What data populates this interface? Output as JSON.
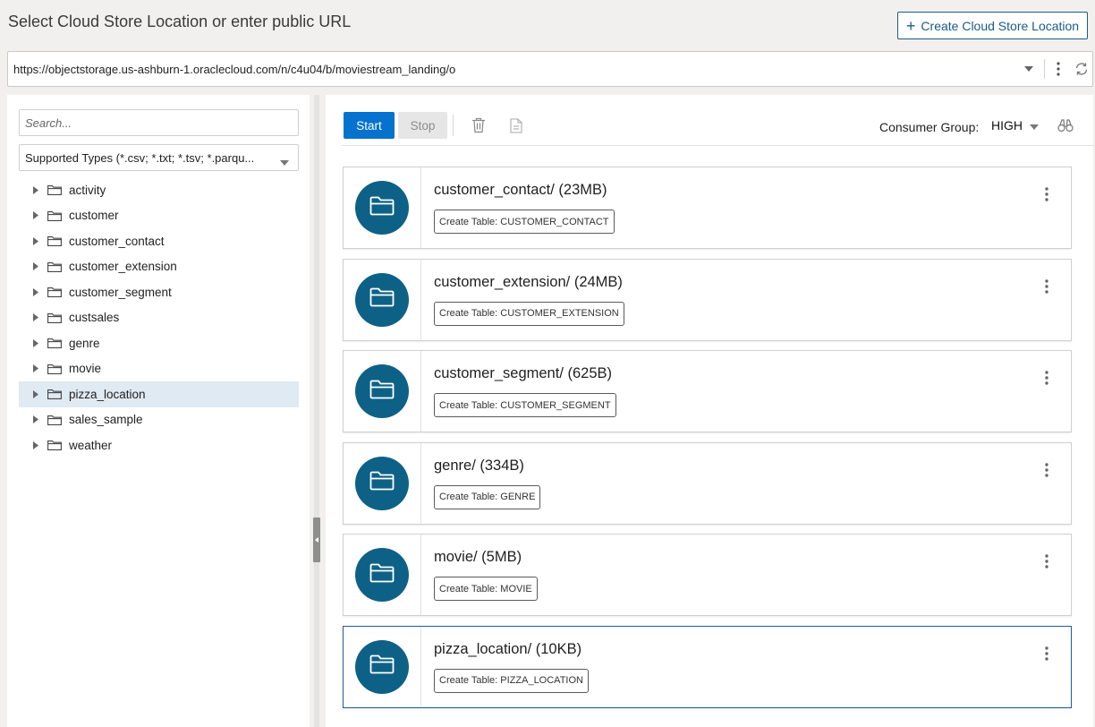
{
  "header": {
    "title": "Select Cloud Store Location or enter public URL",
    "create_button": "Create Cloud Store Location"
  },
  "url_bar": {
    "value": "https://objectstorage.us-ashburn-1.oraclecloud.com/n/c4u04/b/moviestream_landing/o"
  },
  "left": {
    "search_placeholder": "Search...",
    "supported_types": "Supported Types (*.csv; *.txt; *.tsv; *.parqu...",
    "tree": [
      {
        "label": "activity",
        "selected": false
      },
      {
        "label": "customer",
        "selected": false
      },
      {
        "label": "customer_contact",
        "selected": false
      },
      {
        "label": "customer_extension",
        "selected": false
      },
      {
        "label": "customer_segment",
        "selected": false
      },
      {
        "label": "custsales",
        "selected": false
      },
      {
        "label": "genre",
        "selected": false
      },
      {
        "label": "movie",
        "selected": false
      },
      {
        "label": "pizza_location",
        "selected": true
      },
      {
        "label": "sales_sample",
        "selected": false
      },
      {
        "label": "weather",
        "selected": false
      }
    ]
  },
  "toolbar": {
    "start": "Start",
    "stop": "Stop",
    "consumer_group_label": "Consumer Group:",
    "consumer_group_value": "HIGH"
  },
  "cards": [
    {
      "name": "customer_contact/ (23MB)",
      "table": "Create Table: CUSTOMER_CONTACT",
      "selected": false
    },
    {
      "name": "customer_extension/ (24MB)",
      "table": "Create Table: CUSTOMER_EXTENSION",
      "selected": false
    },
    {
      "name": "customer_segment/ (625B)",
      "table": "Create Table: CUSTOMER_SEGMENT",
      "selected": false
    },
    {
      "name": "genre/ (334B)",
      "table": "Create Table: GENRE",
      "selected": false
    },
    {
      "name": "movie/ (5MB)",
      "table": "Create Table: MOVIE",
      "selected": false
    },
    {
      "name": "pizza_location/ (10KB)",
      "table": "Create Table: PIZZA_LOCATION",
      "selected": true
    }
  ],
  "colors": {
    "primary": "#0572ce",
    "avatar": "#0e6186",
    "accent": "#1a5a8a",
    "selected_row": "#dfeaf3"
  },
  "icons": {
    "folder": "folder-icon",
    "trash": "trash-icon",
    "document": "document-icon",
    "binoculars": "binoculars-icon",
    "refresh": "refresh-icon",
    "kebab": "kebab-icon"
  }
}
